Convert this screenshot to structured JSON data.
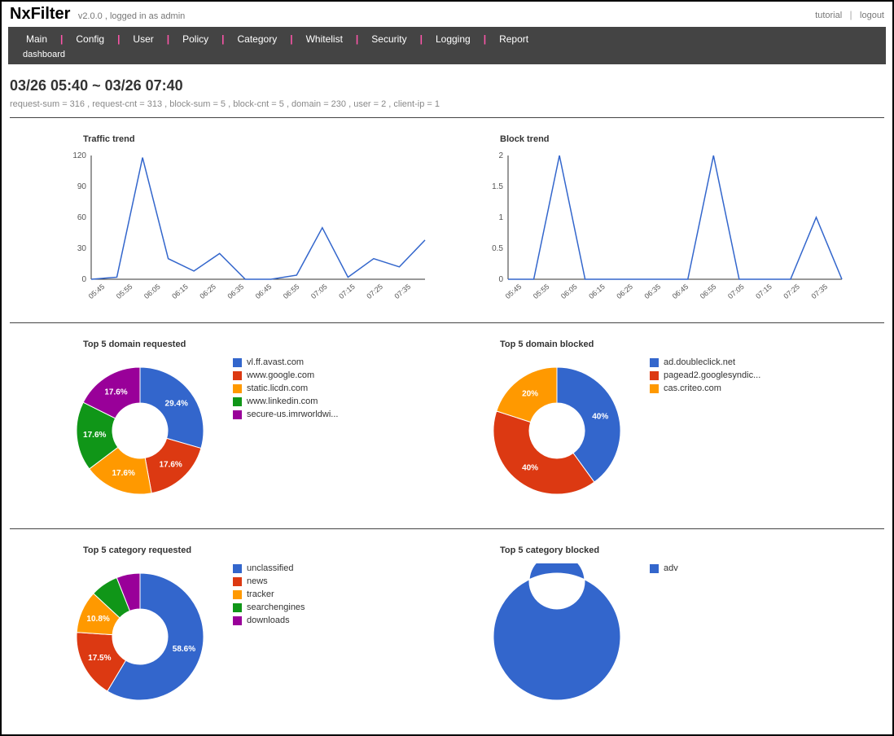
{
  "brand": "NxFilter",
  "version_login": "v2.0.0 , logged in as admin",
  "top_links": {
    "tutorial": "tutorial",
    "logout": "logout"
  },
  "nav": {
    "items": [
      "Main",
      "Config",
      "User",
      "Policy",
      "Category",
      "Whitelist",
      "Security",
      "Logging",
      "Report"
    ],
    "sub": "dashboard"
  },
  "date_range": "03/26 05:40 ~ 03/26 07:40",
  "summary": "request-sum = 316 , request-cnt = 313 , block-sum = 5 , block-cnt = 5 , domain = 230 , user = 2 , client-ip = 1",
  "colors": {
    "c0": "#3366cc",
    "c1": "#dc3912",
    "c2": "#ff9900",
    "c3": "#109618",
    "c4": "#990099"
  },
  "chart_data": [
    {
      "type": "line",
      "title": "Traffic trend",
      "x": [
        "05:45",
        "05:55",
        "06:05",
        "06:15",
        "06:25",
        "06:35",
        "06:45",
        "06:55",
        "07:05",
        "07:15",
        "07:25",
        "07:35"
      ],
      "y": [
        0,
        2,
        118,
        20,
        8,
        25,
        0,
        0,
        4,
        50,
        2,
        20,
        12,
        38
      ],
      "ylim": [
        0,
        120
      ],
      "yticks": [
        0,
        30,
        60,
        90,
        120
      ]
    },
    {
      "type": "line",
      "title": "Block trend",
      "x": [
        "05:45",
        "05:55",
        "06:05",
        "06:15",
        "06:25",
        "06:35",
        "06:45",
        "06:55",
        "07:05",
        "07:15",
        "07:25",
        "07:35"
      ],
      "y": [
        0,
        0,
        2,
        0,
        0,
        0,
        0,
        0,
        2,
        0,
        0,
        0,
        1,
        0
      ],
      "ylim": [
        0,
        2
      ],
      "yticks": [
        0.0,
        0.5,
        1.0,
        1.5,
        2.0
      ]
    },
    {
      "type": "pie",
      "title": "Top 5 domain requested",
      "series": [
        {
          "name": "vl.ff.avast.com",
          "value": 29.4,
          "label": "29.4%"
        },
        {
          "name": "www.google.com",
          "value": 17.6,
          "label": "17.6%"
        },
        {
          "name": "static.licdn.com",
          "value": 17.6,
          "label": "17.6%"
        },
        {
          "name": "www.linkedin.com",
          "value": 17.6,
          "label": "17.6%"
        },
        {
          "name": "secure-us.imrworldwi...",
          "value": 17.6,
          "label": "17.6%"
        }
      ]
    },
    {
      "type": "pie",
      "title": "Top 5 domain blocked",
      "series": [
        {
          "name": "ad.doubleclick.net",
          "value": 40,
          "label": "40%"
        },
        {
          "name": "pagead2.googlesyndic...",
          "value": 40,
          "label": "40%"
        },
        {
          "name": "cas.criteo.com",
          "value": 20,
          "label": "20%"
        }
      ]
    },
    {
      "type": "pie",
      "title": "Top 5 category requested",
      "series": [
        {
          "name": "unclassified",
          "value": 58.6,
          "label": "58.6%"
        },
        {
          "name": "news",
          "value": 17.5,
          "label": "17.5%"
        },
        {
          "name": "tracker",
          "value": 10.8,
          "label": "10.8%"
        },
        {
          "name": "searchengines",
          "value": 7.1,
          "label": ""
        },
        {
          "name": "downloads",
          "value": 6.0,
          "label": ""
        }
      ]
    },
    {
      "type": "pie",
      "title": "Top 5 category blocked",
      "series": [
        {
          "name": "adv",
          "value": 100,
          "label": ""
        }
      ]
    }
  ]
}
